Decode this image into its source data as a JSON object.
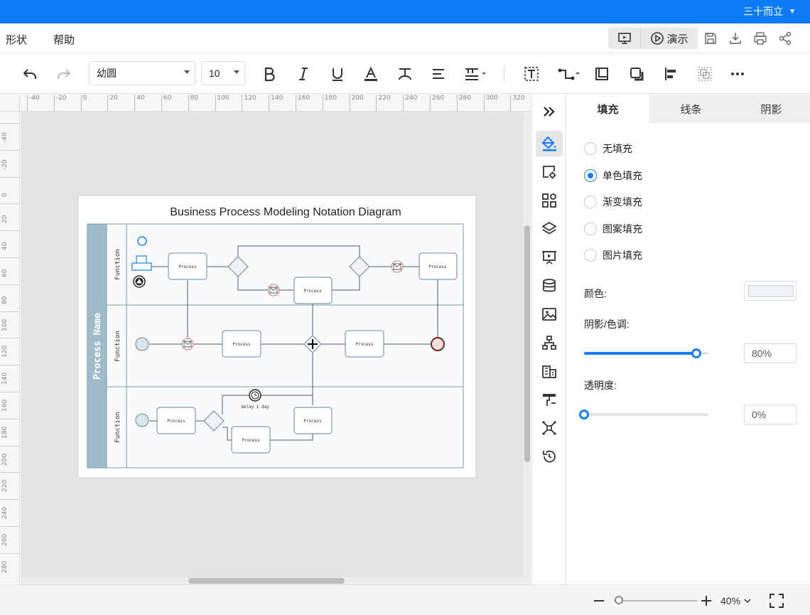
{
  "topbar": {
    "user_name": "三十而立",
    "bg_color": "#0b7cf5"
  },
  "menubar": {
    "menu_shape": "形状",
    "menu_help": "帮助",
    "present_label": "演示",
    "icons": [
      "presentation-icon",
      "play-icon",
      "save-icon",
      "download-icon",
      "print-icon",
      "share-icon"
    ]
  },
  "toolbar": {
    "font_family": "幼圆",
    "font_size": "10",
    "icons": [
      "undo-icon",
      "redo-icon",
      "bold-icon",
      "italic-icon",
      "underline-icon",
      "font-color-icon",
      "text-style-icon",
      "align-icon",
      "line-spacing-icon",
      "text-box-icon",
      "connector-icon",
      "border-icon",
      "shadow-icon",
      "arrange-icon",
      "group-icon",
      "more-icon"
    ]
  },
  "ruler": {
    "h_labels": [
      "-40",
      "-20",
      "0",
      "20",
      "40",
      "60",
      "80",
      "100",
      "120",
      "140",
      "160",
      "180",
      "200",
      "220",
      "240",
      "260",
      "280",
      "300",
      "320"
    ],
    "v_labels": [
      "-40",
      "-20",
      "0",
      "20",
      "40",
      "60",
      "80",
      "100",
      "120",
      "140",
      "160",
      "180",
      "200",
      "220",
      "240",
      "260",
      "280"
    ]
  },
  "diagram": {
    "title": "Business Process Modeling Notation Diagram",
    "pool_name": "Process Name",
    "lane_label": "Function",
    "process_label": "Process",
    "delay_label": "delay 1 day"
  },
  "sidebar": {
    "icons": [
      "collapse-icon",
      "fill-bucket-icon",
      "page-settings-icon",
      "shapes-grid-icon",
      "layers-icon",
      "slideshow-icon",
      "database-icon",
      "image-icon",
      "org-chart-icon",
      "building-icon",
      "format-painter-icon",
      "mindmap-icon",
      "history-icon"
    ]
  },
  "panel": {
    "tabs": [
      "填充",
      "线条",
      "阴影"
    ],
    "fill_options": [
      "无填充",
      "单色填充",
      "渐变填充",
      "图案填充",
      "图片填充"
    ],
    "selected_fill": "单色填充",
    "color_label": "颜色:",
    "color_value": "#eef1f6",
    "shade_label": "阴影/色调:",
    "shade_value": "80%",
    "shade_level": 0.9,
    "opacity_label": "透明度:",
    "opacity_value": "0%",
    "opacity_level": 0
  },
  "statusbar": {
    "zoom": "40%"
  }
}
